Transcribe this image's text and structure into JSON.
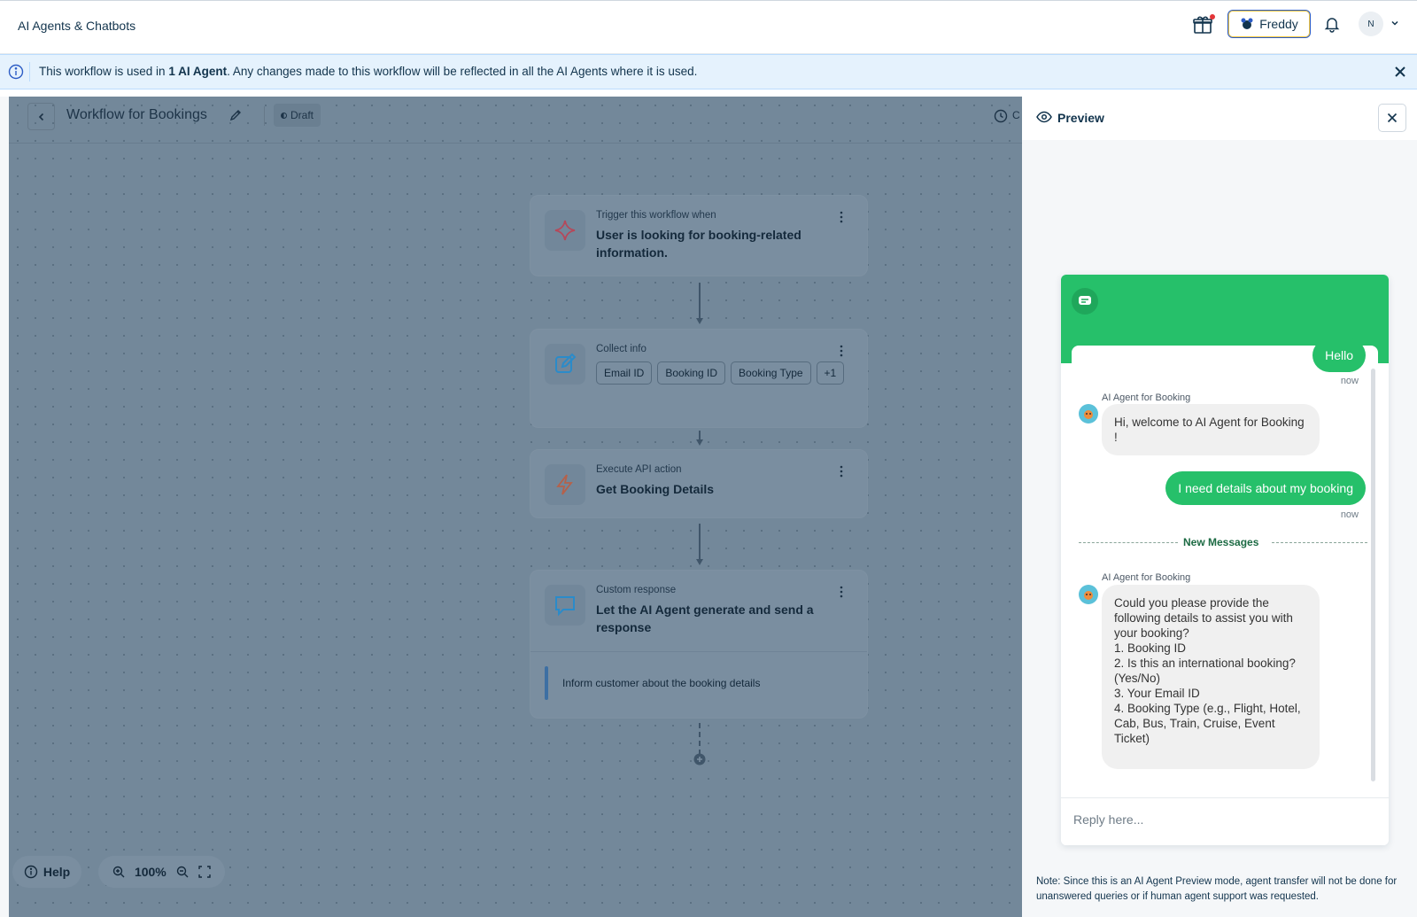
{
  "header": {
    "app_title": "AI Agents & Chatbots",
    "freddy_label": "Freddy",
    "avatar_initial": "N",
    "accent": "#2c5cc5"
  },
  "banner": {
    "text_before": "This workflow is used in ",
    "text_bold": "1 AI Agent",
    "text_after": ". Any changes made to this workflow will be reflected in all the AI Agents where it is used."
  },
  "workflow": {
    "title": "Workflow for Bookings",
    "status": "Draft",
    "clock_text": "C",
    "nodes": [
      {
        "label": "Trigger this workflow when",
        "value": "User is looking for booking-related information.",
        "icon": "sparkle-icon"
      },
      {
        "label": "Collect info",
        "chips": [
          "Email ID",
          "Booking ID",
          "Booking Type",
          "+1"
        ],
        "icon": "edit-icon"
      },
      {
        "label": "Execute API action",
        "value": "Get Booking Details",
        "icon": "lightning-icon"
      },
      {
        "label": "Custom response",
        "value": "Let the AI Agent generate and send a response",
        "footer": "Inform customer about the booking details",
        "icon": "message-icon"
      }
    ]
  },
  "toolbar": {
    "help_label": "Help",
    "zoom_level": "100%"
  },
  "preview": {
    "title": "Preview",
    "brand_color": "#26c06a",
    "messages": {
      "user1": "Hello",
      "user1_time": "now",
      "agent1_name": "AI Agent for Booking",
      "agent1_text": "Hi, welcome to AI Agent for Booking !",
      "user2": "I need details about my booking",
      "user2_time": "now",
      "new_messages": "New Messages",
      "agent2_name": "AI Agent for Booking",
      "agent2_lines": [
        "Could you please provide the following details to assist you with your booking?",
        "1. Booking ID",
        "2. Is this an international booking? (Yes/No)",
        "3. Your Email ID",
        "4. Booking Type (e.g., Flight, Hotel, Cab, Bus, Train, Cruise, Event Ticket)"
      ]
    },
    "reply_placeholder": "Reply here...",
    "note": "Note: Since this is an AI Agent Preview mode, agent transfer will not be done for unanswered queries or if human agent support was requested."
  }
}
